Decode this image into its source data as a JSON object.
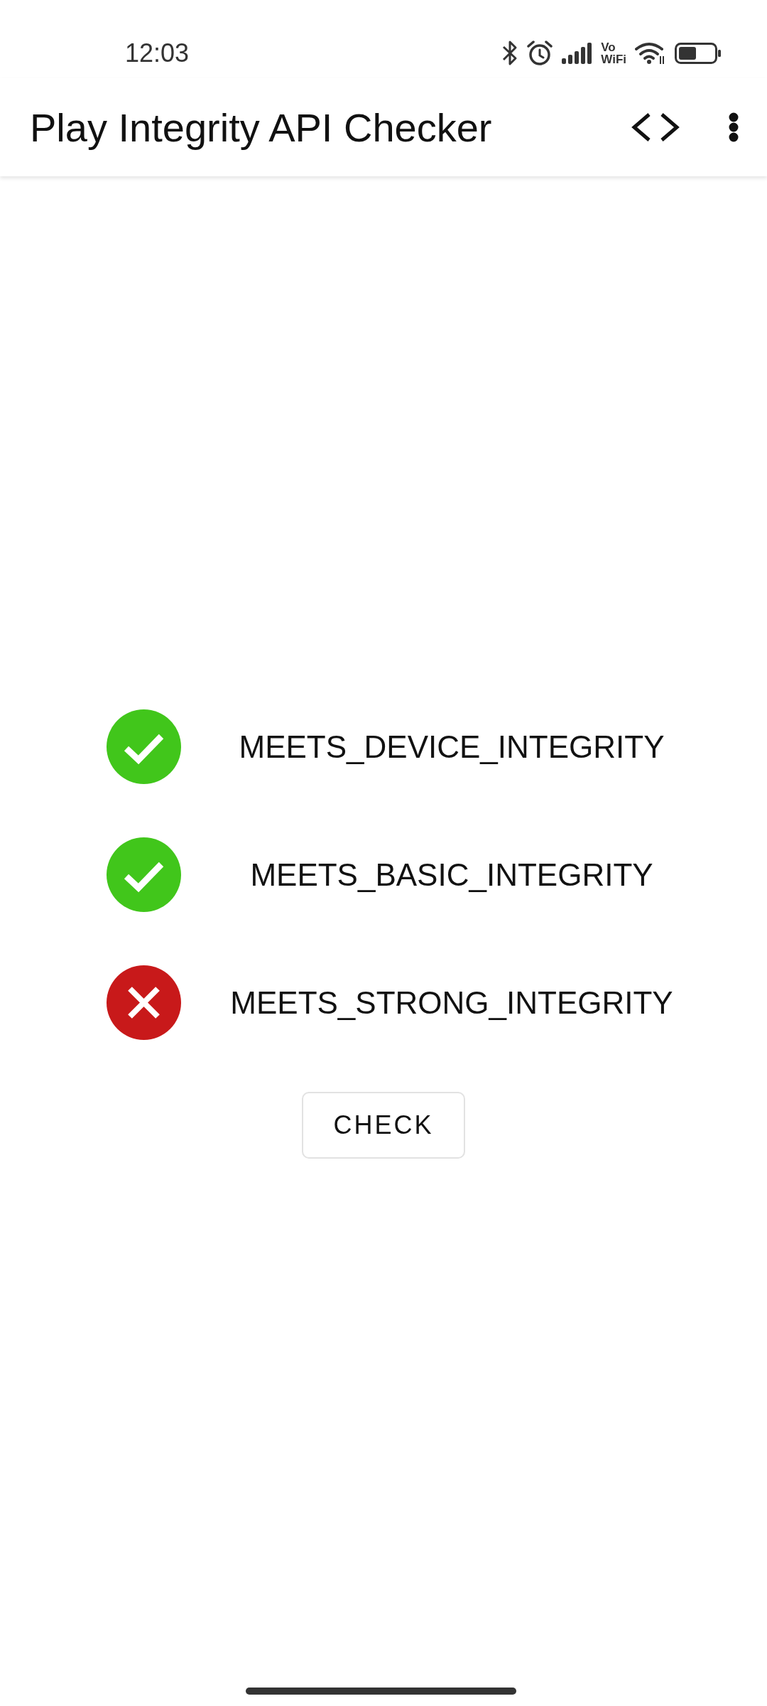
{
  "status_bar": {
    "time": "12:03",
    "vowifi_lines": [
      "Vo",
      "WiFi"
    ]
  },
  "app_bar": {
    "title": "Play Integrity API Checker"
  },
  "results": [
    {
      "label": "MEETS_DEVICE_INTEGRITY",
      "passed": true
    },
    {
      "label": "MEETS_BASIC_INTEGRITY",
      "passed": true
    },
    {
      "label": "MEETS_STRONG_INTEGRITY",
      "passed": false
    }
  ],
  "check_button": {
    "label": "CHECK"
  }
}
